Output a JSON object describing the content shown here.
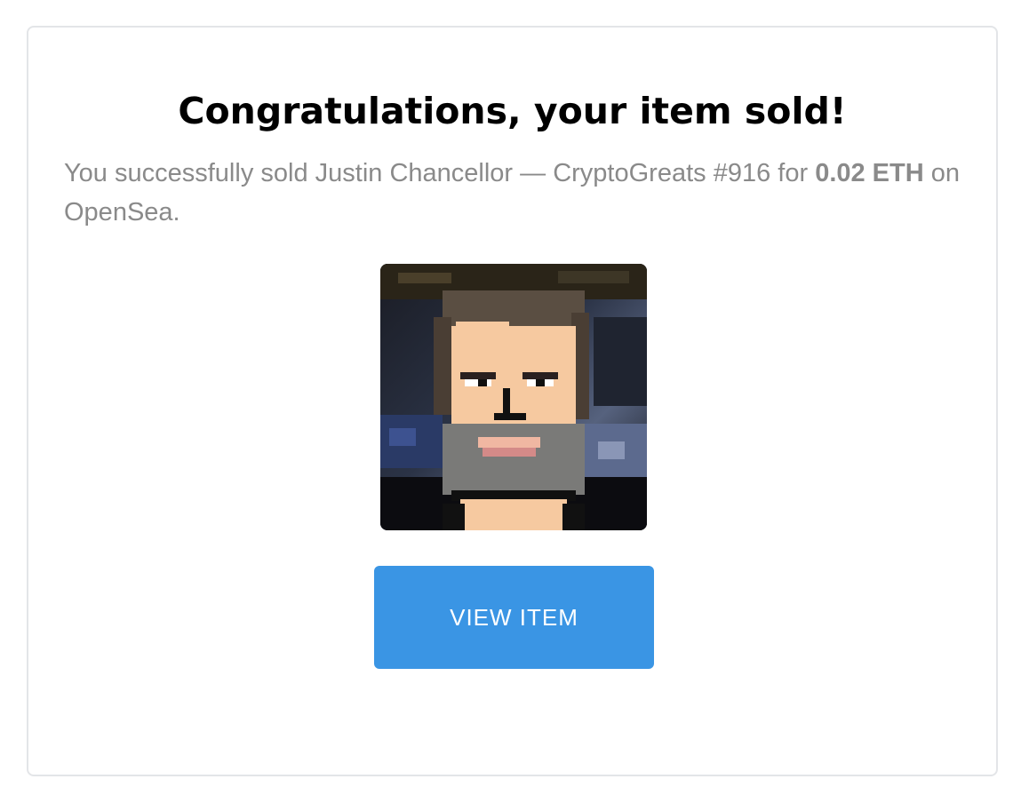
{
  "card": {
    "title": "Congratulations, your item sold!",
    "message": {
      "prefix": "You successfully sold ",
      "item_name": "Justin Chancellor — CryptoGreats #916",
      "for_text": " for ",
      "price": "0.02 ETH",
      "suffix": " on OpenSea."
    },
    "image": {
      "alt": "Justin Chancellor — CryptoGreats #916"
    },
    "view_button_label": "VIEW ITEM"
  },
  "colors": {
    "button": "#3a95e4",
    "message_text": "#8a8a8a",
    "title_text": "#000000",
    "card_border": "#e3e5e8"
  }
}
